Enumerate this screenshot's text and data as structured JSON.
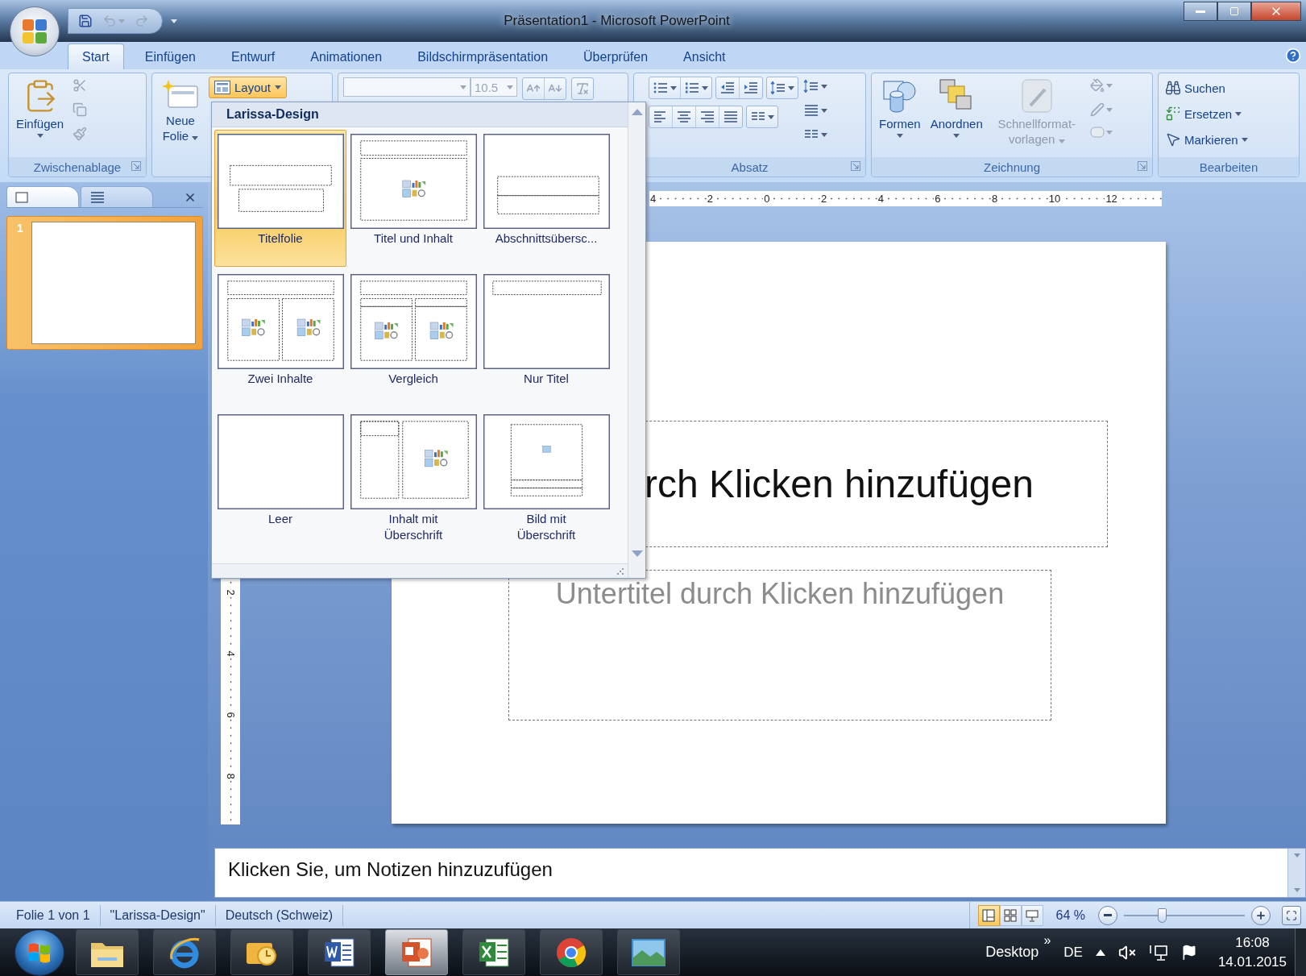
{
  "window": {
    "title": "Präsentation1 - Microsoft PowerPoint"
  },
  "ribbon_tabs": [
    {
      "label": "Start",
      "selected": true
    },
    {
      "label": "Einfügen",
      "selected": false
    },
    {
      "label": "Entwurf",
      "selected": false
    },
    {
      "label": "Animationen",
      "selected": false
    },
    {
      "label": "Bildschirmpräsentation",
      "selected": false
    },
    {
      "label": "Überprüfen",
      "selected": false
    },
    {
      "label": "Ansicht",
      "selected": false
    }
  ],
  "ribbon": {
    "clipboard": {
      "label": "Zwischenablage",
      "paste": "Einfügen"
    },
    "slides": {
      "new_slide": "Neue Folie",
      "layout": "Layout",
      "layout_expanded": true
    },
    "font": {
      "size": "10.5"
    },
    "paragraph": {
      "label": "Absatz"
    },
    "drawing": {
      "label": "Zeichnung",
      "shapes": "Formen",
      "arrange": "Anordnen",
      "quick_styles": "Schnellformat-vorlagen",
      "quick_styles_disabled": true
    },
    "editing": {
      "label": "Bearbeiten",
      "find": "Suchen",
      "replace": "Ersetzen",
      "select": "Markieren"
    }
  },
  "layout_gallery": {
    "title": "Larissa-Design",
    "items": [
      {
        "label": "Titelfolie",
        "kind": "title",
        "selected": true
      },
      {
        "label": "Titel und Inhalt",
        "kind": "title_content",
        "selected": false
      },
      {
        "label": "Abschnittsübersc...",
        "kind": "section",
        "selected": false
      },
      {
        "label": "Zwei Inhalte",
        "kind": "two_content",
        "selected": false
      },
      {
        "label": "Vergleich",
        "kind": "comparison",
        "selected": false
      },
      {
        "label": "Nur Titel",
        "kind": "title_only",
        "selected": false
      },
      {
        "label": "Leer",
        "kind": "blank",
        "selected": false
      },
      {
        "label": "Inhalt mit Überschrift",
        "kind": "content_caption",
        "selected": false
      },
      {
        "label": "Bild mit Überschrift",
        "kind": "picture_caption",
        "selected": false
      }
    ]
  },
  "slide_panel": {
    "tabs": [
      {
        "kind": "slides",
        "selected": true
      },
      {
        "kind": "outline",
        "selected": false
      }
    ],
    "slides": [
      {
        "number": "1",
        "selected": true
      }
    ]
  },
  "ruler": {
    "horizontal": [
      "4",
      "2",
      "0",
      "2",
      "4",
      "6",
      "8",
      "10",
      "12"
    ],
    "vertical": [
      "2",
      "4",
      "6",
      "8"
    ]
  },
  "slide": {
    "title_placeholder": "rch Klicken hinzufügen",
    "subtitle_placeholder": "Untertitel durch Klicken hinzufügen"
  },
  "notes": {
    "text": "Klicken Sie, um Notizen hinzuzufügen"
  },
  "status_bar": {
    "items": [
      "Folie 1 von 1",
      "\"Larissa-Design\"",
      "Deutsch (Schweiz)"
    ],
    "views": [
      {
        "kind": "normal",
        "selected": true
      },
      {
        "kind": "sorter",
        "selected": false
      },
      {
        "kind": "slideshow",
        "selected": false
      }
    ],
    "zoom": "64 %",
    "zoom_slider": {
      "level": 0.31
    }
  },
  "taskbar": {
    "apps": [
      {
        "kind": "folder",
        "selected": false
      },
      {
        "kind": "ie",
        "selected": false
      },
      {
        "kind": "mail",
        "selected": false
      },
      {
        "kind": "word",
        "selected": false
      },
      {
        "kind": "powerpoint",
        "selected": true
      },
      {
        "kind": "excel",
        "selected": false
      },
      {
        "kind": "chrome",
        "selected": false
      },
      {
        "kind": "photo",
        "selected": false
      }
    ],
    "toolbar": "Desktop",
    "chevron": "»",
    "language": "DE",
    "time": "16:08",
    "date": "14.01.2015"
  }
}
